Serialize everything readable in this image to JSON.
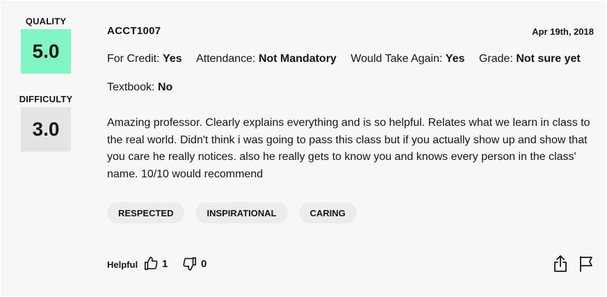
{
  "ratings": {
    "quality_label": "QUALITY",
    "quality_value": "5.0",
    "difficulty_label": "DIFFICULTY",
    "difficulty_value": "3.0"
  },
  "review": {
    "course": "ACCT1007",
    "date": "Apr 19th, 2018",
    "meta": [
      {
        "label": "For Credit:",
        "value": "Yes"
      },
      {
        "label": "Attendance:",
        "value": "Not Mandatory"
      },
      {
        "label": "Would Take Again:",
        "value": "Yes"
      },
      {
        "label": "Grade:",
        "value": "Not sure yet"
      },
      {
        "label": "Textbook:",
        "value": "No"
      }
    ],
    "comment": "Amazing professor. Clearly explains everything and is so helpful. Relates what we learn in class to the real world. Didn't think i was going to pass this class but if you actually show up and show that you care he really notices. also he really gets to know you and knows every person in the class' name. 10/10 would recommend",
    "tags": [
      "RESPECTED",
      "INSPIRATIONAL",
      "CARING"
    ]
  },
  "footer": {
    "helpful_label": "Helpful",
    "thumbs_up_count": "1",
    "thumbs_down_count": "0"
  },
  "colors": {
    "quality_bg": "#7ff6c3",
    "difficulty_bg": "#e4e4e4",
    "card_bg": "#f7f7f7",
    "tag_bg": "#ececec"
  },
  "icons": [
    "thumbs-up-icon",
    "thumbs-down-icon",
    "share-icon",
    "flag-icon"
  ]
}
